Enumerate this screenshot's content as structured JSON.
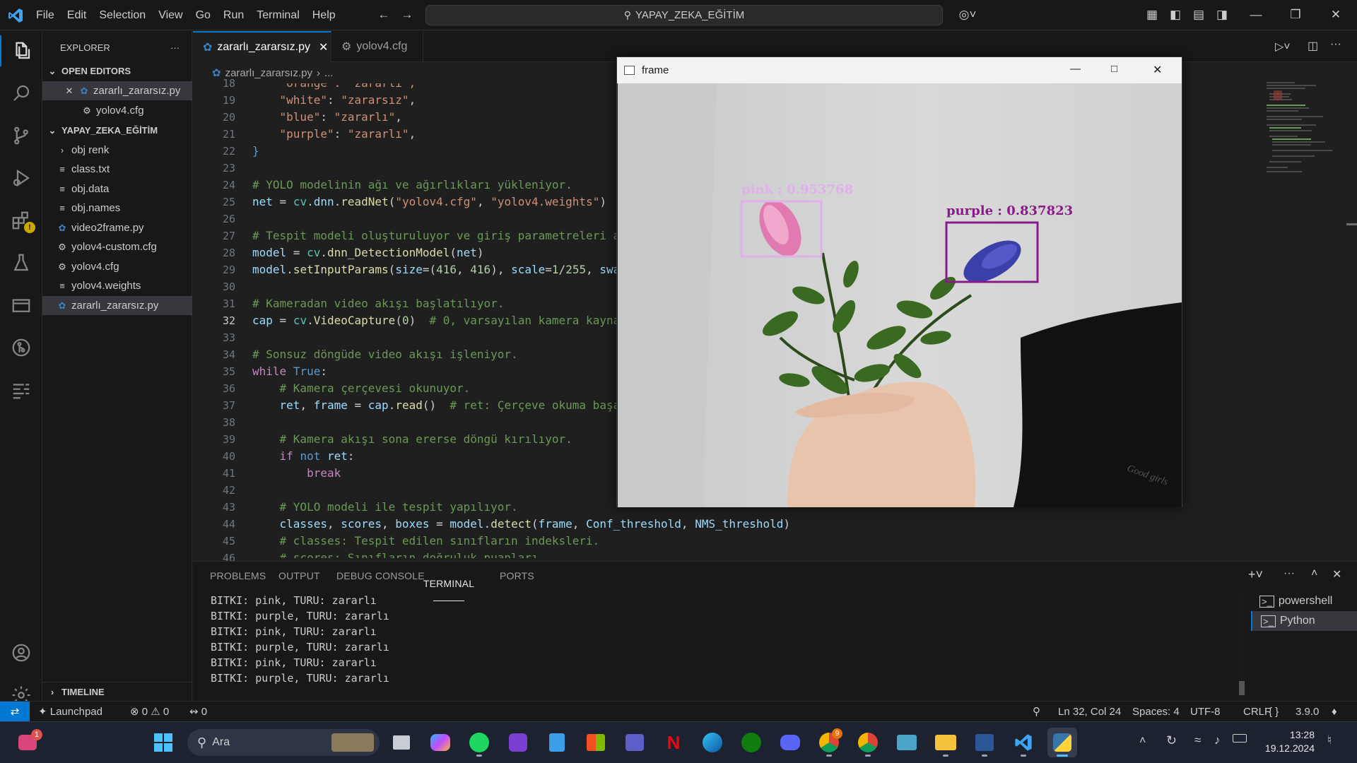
{
  "titlebar": {
    "menu": [
      "File",
      "Edit",
      "Selection",
      "View",
      "Go",
      "Run",
      "Terminal",
      "Help"
    ],
    "search": "YAPAY_ZEKA_EĞİTİM"
  },
  "sidebar": {
    "title": "EXPLORER",
    "open_editors_header": "OPEN EDITORS",
    "open_editors": [
      "zararlı_zararsız.py",
      "yolov4.cfg"
    ],
    "folder_header": "YAPAY_ZEKA_EĞİTİM",
    "files": [
      "obj renk",
      "class.txt",
      "obj.data",
      "obj.names",
      "video2frame.py",
      "yolov4-custom.cfg",
      "yolov4.cfg",
      "yolov4.weights",
      "zararlı_zararsız.py"
    ],
    "timeline": "TIMELINE"
  },
  "tabs": [
    "zararlı_zararsız.py",
    "yolov4.cfg"
  ],
  "breadcrumb": {
    "file": "zararlı_zararsız.py",
    "rest": "..."
  },
  "editor": {
    "line_numbers": [
      "18",
      "19",
      "20",
      "21",
      "22",
      "23",
      "24",
      "25",
      "26",
      "27",
      "28",
      "29",
      "30",
      "31",
      "32",
      "33",
      "34",
      "35",
      "36",
      "37",
      "38",
      "39",
      "40",
      "41",
      "42",
      "43",
      "44",
      "45",
      "46"
    ],
    "current_line": "32"
  },
  "frame_window": {
    "title": "frame",
    "detections": [
      {
        "label": "pink : 0.953768",
        "color": "#e0b0e8"
      },
      {
        "label": "purple : 0.837823",
        "color": "#8a1a8a"
      }
    ]
  },
  "panel": {
    "tabs": [
      "PROBLEMS",
      "OUTPUT",
      "DEBUG CONSOLE",
      "TERMINAL",
      "PORTS"
    ],
    "active_tab": "TERMINAL",
    "terminal_lines": [
      "BITKI: pink, TURU: zararlı",
      "BITKI: purple, TURU: zararlı",
      "BITKI: pink, TURU: zararlı",
      "BITKI: purple, TURU: zararlı",
      "BITKI: pink, TURU: zararlı",
      "BITKI: purple, TURU: zararlı"
    ],
    "terminals": [
      "powershell",
      "Python"
    ]
  },
  "statusbar": {
    "launchpad": "Launchpad",
    "errors": "0",
    "warnings": "0",
    "ports": "0",
    "position": "Ln 32, Col 24",
    "spaces": "Spaces: 4",
    "encoding": "UTF-8",
    "eol": "CRLF",
    "language": "{ }",
    "python_version": "3.9.0"
  },
  "taskbar": {
    "search": "Ara",
    "time": "13:28",
    "date": "19.12.2024",
    "chrome_badge": "9",
    "teams_badge": "1"
  },
  "colors": {
    "accent": "#0078d4",
    "background": "#1f1f1f",
    "sidebar": "#181818"
  }
}
